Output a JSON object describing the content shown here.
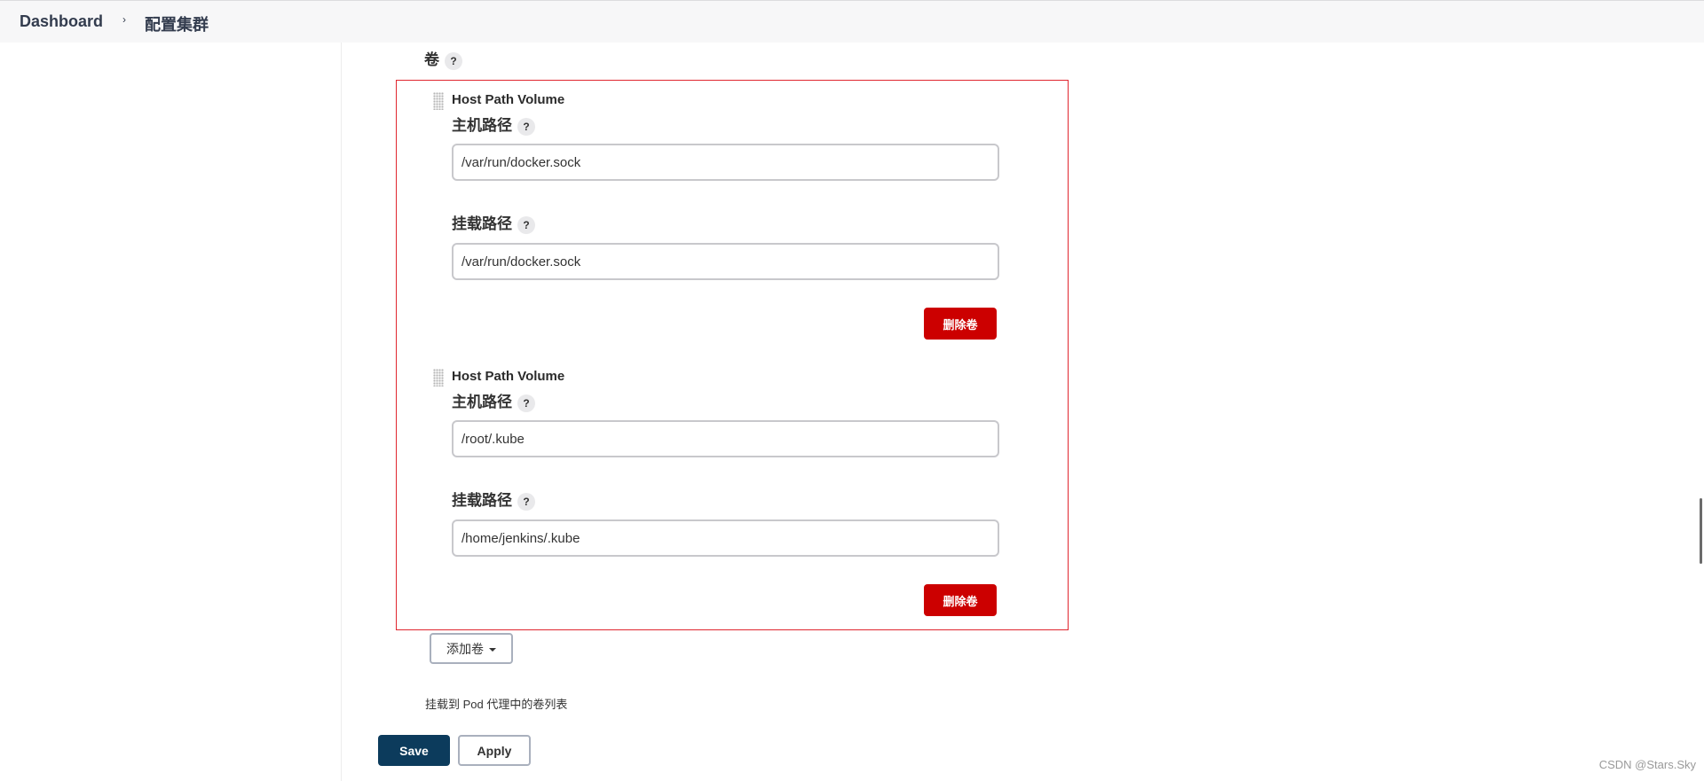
{
  "breadcrumb": {
    "dashboard": "Dashboard",
    "separator": "›",
    "current": "配置集群"
  },
  "volumes_section": {
    "label": "卷",
    "help": "?",
    "volumes": [
      {
        "type": "Host Path Volume",
        "host_path_label": "主机路径",
        "host_path_value": "/var/run/docker.sock",
        "mount_path_label": "挂载路径",
        "mount_path_value": "/var/run/docker.sock",
        "delete_label": "删除卷"
      },
      {
        "type": "Host Path Volume",
        "host_path_label": "主机路径",
        "host_path_value": "/root/.kube",
        "mount_path_label": "挂载路径",
        "mount_path_value": "/home/jenkins/.kube",
        "delete_label": "删除卷"
      }
    ],
    "add_label": "添加卷",
    "description": "挂载到 Pod 代理中的卷列表"
  },
  "actions": {
    "save": "Save",
    "apply": "Apply"
  },
  "watermark": "CSDN @Stars.Sky",
  "colors": {
    "delete_button": "#cc0000",
    "save_button": "#0c3b5c",
    "highlight_border": "#e0262f"
  }
}
